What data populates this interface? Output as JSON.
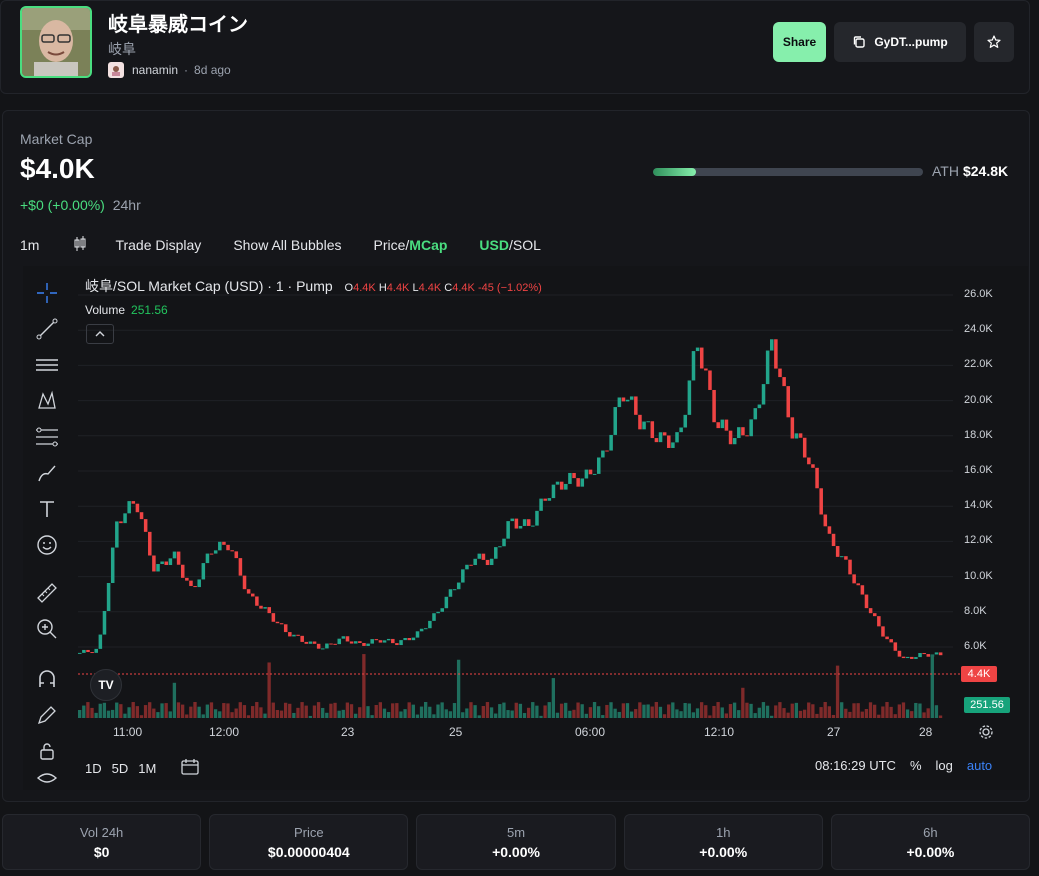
{
  "token": {
    "name": "岐阜暴威コイン",
    "symbol": "岐阜",
    "creator": "nanamin",
    "separator": "·",
    "age": "8d ago"
  },
  "actions": {
    "share_label": "Share",
    "copy_label": "GyDT...pump"
  },
  "market": {
    "label": "Market Cap",
    "value": "$4.0K",
    "change": "+$0 (+0.00%)",
    "period": "24hr",
    "ath_label": "ATH",
    "ath_value": "$24.8K",
    "ath_progress": 0.16
  },
  "toolbar": {
    "interval": "1m",
    "trade_display": "Trade Display",
    "show_bubbles": "Show All Bubbles",
    "price_label": "Price/",
    "mcap_label": "MCap",
    "usd_label": "USD",
    "sol_label": "/SOL"
  },
  "chart": {
    "title": "岐阜/SOL Market Cap (USD) · 1 · Pump",
    "o_label": "O",
    "o": "4.4K",
    "h_label": "H",
    "h": "4.4K",
    "l_label": "L",
    "l": "4.4K",
    "c_label": "C",
    "c": "4.4K",
    "chg": "-45 (−1.02%)",
    "volume_label": "Volume",
    "volume_value": "251.56",
    "price_tag": "4.4K",
    "vol_tag": "251.56",
    "time": "08:16:29 UTC",
    "ranges": [
      "1D",
      "5D",
      "1M"
    ],
    "pct": "%",
    "log": "log",
    "auto": "auto",
    "yticks": [
      "26.0K",
      "24.0K",
      "22.0K",
      "20.0K",
      "18.0K",
      "16.0K",
      "14.0K",
      "12.0K",
      "10.0K",
      "8.0K",
      "6.0K"
    ],
    "xticks": [
      "11:00",
      "12:00",
      "23",
      "25",
      "06:00",
      "12:10",
      "27",
      "28"
    ]
  },
  "chart_data": {
    "type": "candlestick",
    "title": "岐阜/SOL Market Cap (USD) · 1 · Pump",
    "ylim": [
      2000,
      27000
    ],
    "x": [
      "11:00",
      "12:00",
      "23",
      "25",
      "06:00",
      "12:10",
      "27",
      "28"
    ],
    "close": [
      4500,
      4700,
      12500,
      13800,
      9500,
      10500,
      8200,
      10800,
      11100,
      8000,
      7000,
      5800,
      5200,
      4800,
      5400,
      5000,
      5300,
      5100,
      5600,
      6800,
      8500,
      10300,
      10100,
      12500,
      12200,
      14200,
      15000,
      15100,
      16500,
      20500,
      18500,
      17500,
      17400,
      23500,
      18500,
      17500,
      18500,
      23500,
      18200,
      16200,
      11500,
      9800,
      7500,
      5500,
      4100,
      4400,
      4400
    ],
    "volume_last": 251.56
  },
  "stats": [
    {
      "label": "Vol 24h",
      "value": "$0"
    },
    {
      "label": "Price",
      "value": "$0.00000404"
    },
    {
      "label": "5m",
      "value": "+0.00%"
    },
    {
      "label": "1h",
      "value": "+0.00%"
    },
    {
      "label": "6h",
      "value": "+0.00%"
    }
  ],
  "colors": {
    "up": "#22a58b",
    "down": "#ef4444",
    "accent": "#4ade80"
  }
}
